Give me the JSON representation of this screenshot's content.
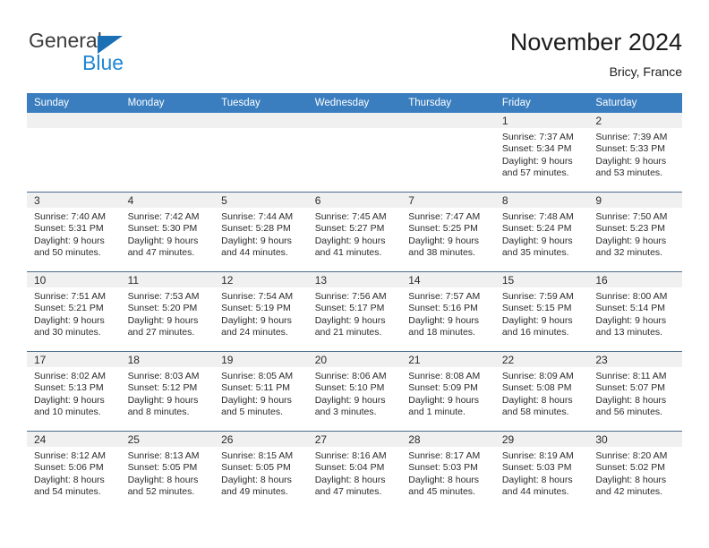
{
  "brand": {
    "name_top": "General",
    "name_bottom": "Blue",
    "triangle_color": "#1b6fb5",
    "blue_color": "#2087d4"
  },
  "header": {
    "month_title": "November 2024",
    "location": "Bricy, France",
    "header_bg_color": "#3a7ebf",
    "header_text_color": "#ffffff"
  },
  "weekday_headers": [
    "Sunday",
    "Monday",
    "Tuesday",
    "Wednesday",
    "Thursday",
    "Friday",
    "Saturday"
  ],
  "labels": {
    "sunrise_prefix": "Sunrise:",
    "sunset_prefix": "Sunset:",
    "daylight_prefix": "Daylight:"
  },
  "weeks": [
    [
      {
        "day": "",
        "sunrise": "",
        "sunset": "",
        "daylight_line1": "",
        "daylight_line2": ""
      },
      {
        "day": "",
        "sunrise": "",
        "sunset": "",
        "daylight_line1": "",
        "daylight_line2": ""
      },
      {
        "day": "",
        "sunrise": "",
        "sunset": "",
        "daylight_line1": "",
        "daylight_line2": ""
      },
      {
        "day": "",
        "sunrise": "",
        "sunset": "",
        "daylight_line1": "",
        "daylight_line2": ""
      },
      {
        "day": "",
        "sunrise": "",
        "sunset": "",
        "daylight_line1": "",
        "daylight_line2": ""
      },
      {
        "day": "1",
        "sunrise": "Sunrise: 7:37 AM",
        "sunset": "Sunset: 5:34 PM",
        "daylight_line1": "Daylight: 9 hours",
        "daylight_line2": "and 57 minutes."
      },
      {
        "day": "2",
        "sunrise": "Sunrise: 7:39 AM",
        "sunset": "Sunset: 5:33 PM",
        "daylight_line1": "Daylight: 9 hours",
        "daylight_line2": "and 53 minutes."
      }
    ],
    [
      {
        "day": "3",
        "sunrise": "Sunrise: 7:40 AM",
        "sunset": "Sunset: 5:31 PM",
        "daylight_line1": "Daylight: 9 hours",
        "daylight_line2": "and 50 minutes."
      },
      {
        "day": "4",
        "sunrise": "Sunrise: 7:42 AM",
        "sunset": "Sunset: 5:30 PM",
        "daylight_line1": "Daylight: 9 hours",
        "daylight_line2": "and 47 minutes."
      },
      {
        "day": "5",
        "sunrise": "Sunrise: 7:44 AM",
        "sunset": "Sunset: 5:28 PM",
        "daylight_line1": "Daylight: 9 hours",
        "daylight_line2": "and 44 minutes."
      },
      {
        "day": "6",
        "sunrise": "Sunrise: 7:45 AM",
        "sunset": "Sunset: 5:27 PM",
        "daylight_line1": "Daylight: 9 hours",
        "daylight_line2": "and 41 minutes."
      },
      {
        "day": "7",
        "sunrise": "Sunrise: 7:47 AM",
        "sunset": "Sunset: 5:25 PM",
        "daylight_line1": "Daylight: 9 hours",
        "daylight_line2": "and 38 minutes."
      },
      {
        "day": "8",
        "sunrise": "Sunrise: 7:48 AM",
        "sunset": "Sunset: 5:24 PM",
        "daylight_line1": "Daylight: 9 hours",
        "daylight_line2": "and 35 minutes."
      },
      {
        "day": "9",
        "sunrise": "Sunrise: 7:50 AM",
        "sunset": "Sunset: 5:23 PM",
        "daylight_line1": "Daylight: 9 hours",
        "daylight_line2": "and 32 minutes."
      }
    ],
    [
      {
        "day": "10",
        "sunrise": "Sunrise: 7:51 AM",
        "sunset": "Sunset: 5:21 PM",
        "daylight_line1": "Daylight: 9 hours",
        "daylight_line2": "and 30 minutes."
      },
      {
        "day": "11",
        "sunrise": "Sunrise: 7:53 AM",
        "sunset": "Sunset: 5:20 PM",
        "daylight_line1": "Daylight: 9 hours",
        "daylight_line2": "and 27 minutes."
      },
      {
        "day": "12",
        "sunrise": "Sunrise: 7:54 AM",
        "sunset": "Sunset: 5:19 PM",
        "daylight_line1": "Daylight: 9 hours",
        "daylight_line2": "and 24 minutes."
      },
      {
        "day": "13",
        "sunrise": "Sunrise: 7:56 AM",
        "sunset": "Sunset: 5:17 PM",
        "daylight_line1": "Daylight: 9 hours",
        "daylight_line2": "and 21 minutes."
      },
      {
        "day": "14",
        "sunrise": "Sunrise: 7:57 AM",
        "sunset": "Sunset: 5:16 PM",
        "daylight_line1": "Daylight: 9 hours",
        "daylight_line2": "and 18 minutes."
      },
      {
        "day": "15",
        "sunrise": "Sunrise: 7:59 AM",
        "sunset": "Sunset: 5:15 PM",
        "daylight_line1": "Daylight: 9 hours",
        "daylight_line2": "and 16 minutes."
      },
      {
        "day": "16",
        "sunrise": "Sunrise: 8:00 AM",
        "sunset": "Sunset: 5:14 PM",
        "daylight_line1": "Daylight: 9 hours",
        "daylight_line2": "and 13 minutes."
      }
    ],
    [
      {
        "day": "17",
        "sunrise": "Sunrise: 8:02 AM",
        "sunset": "Sunset: 5:13 PM",
        "daylight_line1": "Daylight: 9 hours",
        "daylight_line2": "and 10 minutes."
      },
      {
        "day": "18",
        "sunrise": "Sunrise: 8:03 AM",
        "sunset": "Sunset: 5:12 PM",
        "daylight_line1": "Daylight: 9 hours",
        "daylight_line2": "and 8 minutes."
      },
      {
        "day": "19",
        "sunrise": "Sunrise: 8:05 AM",
        "sunset": "Sunset: 5:11 PM",
        "daylight_line1": "Daylight: 9 hours",
        "daylight_line2": "and 5 minutes."
      },
      {
        "day": "20",
        "sunrise": "Sunrise: 8:06 AM",
        "sunset": "Sunset: 5:10 PM",
        "daylight_line1": "Daylight: 9 hours",
        "daylight_line2": "and 3 minutes."
      },
      {
        "day": "21",
        "sunrise": "Sunrise: 8:08 AM",
        "sunset": "Sunset: 5:09 PM",
        "daylight_line1": "Daylight: 9 hours",
        "daylight_line2": "and 1 minute."
      },
      {
        "day": "22",
        "sunrise": "Sunrise: 8:09 AM",
        "sunset": "Sunset: 5:08 PM",
        "daylight_line1": "Daylight: 8 hours",
        "daylight_line2": "and 58 minutes."
      },
      {
        "day": "23",
        "sunrise": "Sunrise: 8:11 AM",
        "sunset": "Sunset: 5:07 PM",
        "daylight_line1": "Daylight: 8 hours",
        "daylight_line2": "and 56 minutes."
      }
    ],
    [
      {
        "day": "24",
        "sunrise": "Sunrise: 8:12 AM",
        "sunset": "Sunset: 5:06 PM",
        "daylight_line1": "Daylight: 8 hours",
        "daylight_line2": "and 54 minutes."
      },
      {
        "day": "25",
        "sunrise": "Sunrise: 8:13 AM",
        "sunset": "Sunset: 5:05 PM",
        "daylight_line1": "Daylight: 8 hours",
        "daylight_line2": "and 52 minutes."
      },
      {
        "day": "26",
        "sunrise": "Sunrise: 8:15 AM",
        "sunset": "Sunset: 5:05 PM",
        "daylight_line1": "Daylight: 8 hours",
        "daylight_line2": "and 49 minutes."
      },
      {
        "day": "27",
        "sunrise": "Sunrise: 8:16 AM",
        "sunset": "Sunset: 5:04 PM",
        "daylight_line1": "Daylight: 8 hours",
        "daylight_line2": "and 47 minutes."
      },
      {
        "day": "28",
        "sunrise": "Sunrise: 8:17 AM",
        "sunset": "Sunset: 5:03 PM",
        "daylight_line1": "Daylight: 8 hours",
        "daylight_line2": "and 45 minutes."
      },
      {
        "day": "29",
        "sunrise": "Sunrise: 8:19 AM",
        "sunset": "Sunset: 5:03 PM",
        "daylight_line1": "Daylight: 8 hours",
        "daylight_line2": "and 44 minutes."
      },
      {
        "day": "30",
        "sunrise": "Sunrise: 8:20 AM",
        "sunset": "Sunset: 5:02 PM",
        "daylight_line1": "Daylight: 8 hours",
        "daylight_line2": "and 42 minutes."
      }
    ]
  ]
}
